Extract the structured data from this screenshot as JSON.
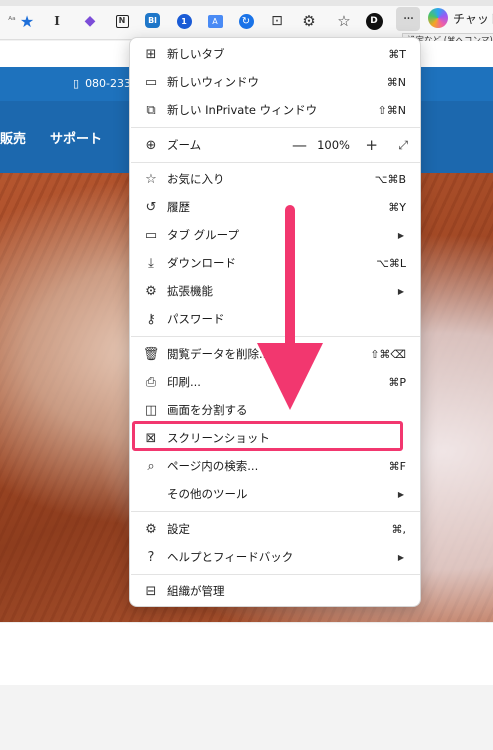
{
  "toolbar": {
    "icons": [
      "aa-icon",
      "favorite-star-icon",
      "i-icon",
      "obsidian-icon",
      "notion-icon",
      "bl-icon",
      "1password-icon",
      "translate-icon",
      "refresh-icon",
      "screenshot-icon",
      "extensions-icon",
      "favorites-icon",
      "dark-reader-icon",
      "more-icon"
    ],
    "more_label": "···",
    "copilot_label": "チャット",
    "tooltip": "設定など (⌘へコンマ)"
  },
  "page": {
    "phone": "080-233",
    "nav": [
      "販売",
      "サポート"
    ]
  },
  "menu": {
    "items": [
      {
        "name": "new-tab",
        "icon": "new-tab-icon",
        "label": "新しいタブ",
        "shortcut": "⌘T"
      },
      {
        "name": "new-window",
        "icon": "new-window-icon",
        "label": "新しいウィンドウ",
        "shortcut": "⌘N"
      },
      {
        "name": "new-inprivate",
        "icon": "inprivate-icon",
        "label": "新しい InPrivate ウィンドウ",
        "shortcut": "⇧⌘N"
      },
      {
        "name": "zoom",
        "icon": "zoom-icon",
        "label": "ズーム",
        "value": "100%",
        "minus": "—",
        "plus": "+",
        "full": "⤢"
      },
      {
        "name": "favorites",
        "icon": "favorites-icon",
        "label": "お気に入り",
        "shortcut": "⌥⌘B"
      },
      {
        "name": "history",
        "icon": "history-icon",
        "label": "履歴",
        "shortcut": "⌘Y"
      },
      {
        "name": "tab-groups",
        "icon": "tab-groups-icon",
        "label": "タブ グループ",
        "arrow": "▶"
      },
      {
        "name": "downloads",
        "icon": "download-icon",
        "label": "ダウンロード",
        "shortcut": "⌥⌘L"
      },
      {
        "name": "extensions",
        "icon": "extensions-icon",
        "label": "拡張機能",
        "arrow": "▶"
      },
      {
        "name": "passwords",
        "icon": "key-icon",
        "label": "パスワード"
      },
      {
        "name": "clear-data",
        "icon": "trash-icon",
        "label": "閲覧データを削除...",
        "shortcut": "⇧⌘⌫"
      },
      {
        "name": "print",
        "icon": "print-icon",
        "label": "印刷...",
        "shortcut": "⌘P"
      },
      {
        "name": "split-screen",
        "icon": "split-screen-icon",
        "label": "画面を分割する"
      },
      {
        "name": "screenshot",
        "icon": "screenshot-icon",
        "label": "スクリーンショット"
      },
      {
        "name": "find-in-page",
        "icon": "find-in-page-icon",
        "label": "ページ内の検索...",
        "shortcut": "⌘F"
      },
      {
        "name": "more-tools",
        "icon": "",
        "label": "その他のツール",
        "arrow": "▶"
      },
      {
        "name": "settings",
        "icon": "gear-icon",
        "label": "設定",
        "shortcut": "⌘,"
      },
      {
        "name": "help-feedback",
        "icon": "help-icon",
        "label": "ヘルプとフィードバック",
        "arrow": "▶"
      },
      {
        "name": "managed-by-org",
        "icon": "briefcase-icon",
        "label": "組織が管理"
      }
    ]
  },
  "annotation": {
    "arrow_color": "#f2376f",
    "highlight_target": "screenshot"
  }
}
